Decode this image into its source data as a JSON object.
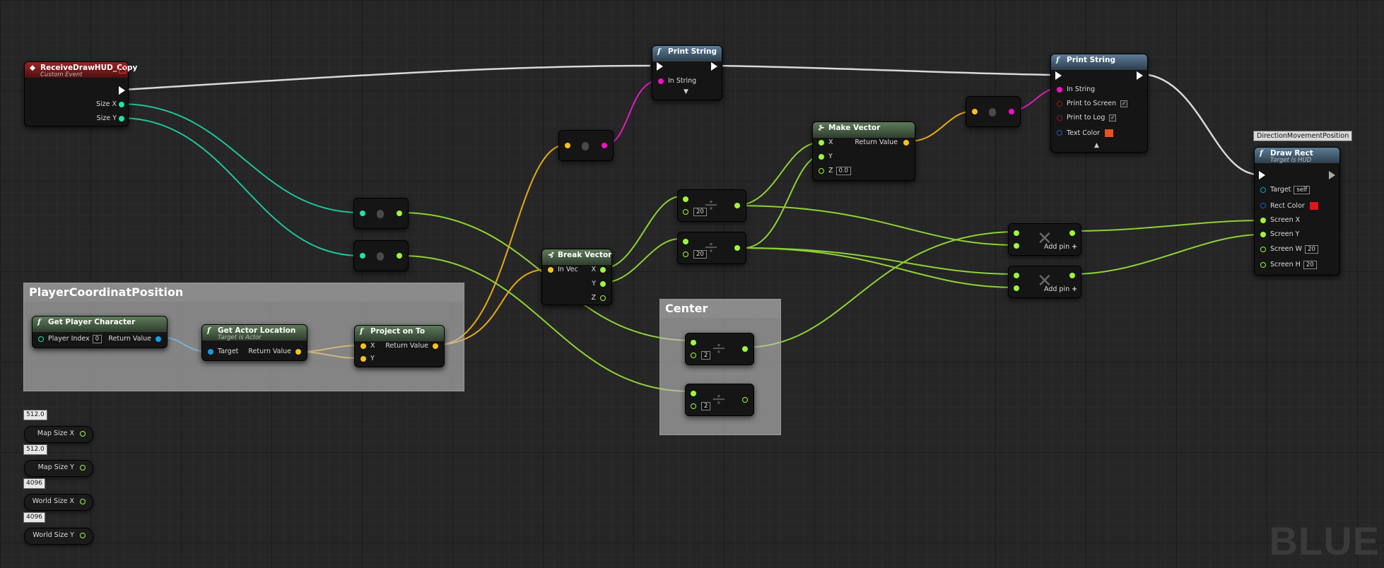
{
  "event_node": {
    "title": "ReceiveDrawHUD_Copy",
    "subtitle": "Custom Event",
    "pins": [
      "Size X",
      "Size Y"
    ]
  },
  "print1": {
    "title": "Print String",
    "pins": [
      "In String"
    ]
  },
  "print2": {
    "title": "Print String",
    "pins": [
      "In String",
      "Print to Screen",
      "Print to Log",
      "Text Color"
    ],
    "text_color": "#e8541a"
  },
  "make_vector": {
    "title": "Make Vector",
    "pins": [
      "X",
      "Y",
      "Z"
    ],
    "z_value": "0.0",
    "out": "Return Value"
  },
  "break_vector": {
    "title": "Break Vector",
    "in": "In Vec",
    "outs": [
      "X",
      "Y",
      "Z"
    ]
  },
  "draw_rect": {
    "tag": "DirectionMovementPosition",
    "title": "Draw Rect",
    "subtitle": "Target is HUD",
    "pins": [
      "Target",
      "Rect Color",
      "Screen X",
      "Screen Y",
      "Screen W",
      "Screen H"
    ],
    "target_value": "self",
    "rect_color": "#e0161a",
    "screen_w": "20",
    "screen_h": "20"
  },
  "comment_player": {
    "title": "PlayerCoordinatPosition"
  },
  "get_player": {
    "title": "Get Player Character",
    "pin": "Player Index",
    "value": "0",
    "out": "Return Value"
  },
  "get_actor": {
    "title": "Get Actor Location",
    "subtitle": "Target is Actor",
    "pin": "Target",
    "out": "Return Value"
  },
  "project": {
    "title": "Project on To",
    "pins": [
      "X",
      "Y"
    ],
    "out": "Return Value"
  },
  "comment_center": {
    "title": "Center"
  },
  "div_values": {
    "a": "20",
    "b": "20",
    "c": "2",
    "d": "2"
  },
  "add_pin_label": "Add pin",
  "variables": [
    {
      "name": "Map Size X",
      "value": "512.0"
    },
    {
      "name": "Map Size Y",
      "value": "512.0"
    },
    {
      "name": "World Size X",
      "value": "4096"
    },
    {
      "name": "World Size Y",
      "value": "4096"
    }
  ],
  "watermark": "BLUE",
  "colors": {
    "exec": "#ffffff",
    "float": "#9ef73a",
    "vector": "#f7c21f",
    "string": "#f20fc4",
    "object": "#10a0e6",
    "int": "#1fe3aa"
  }
}
